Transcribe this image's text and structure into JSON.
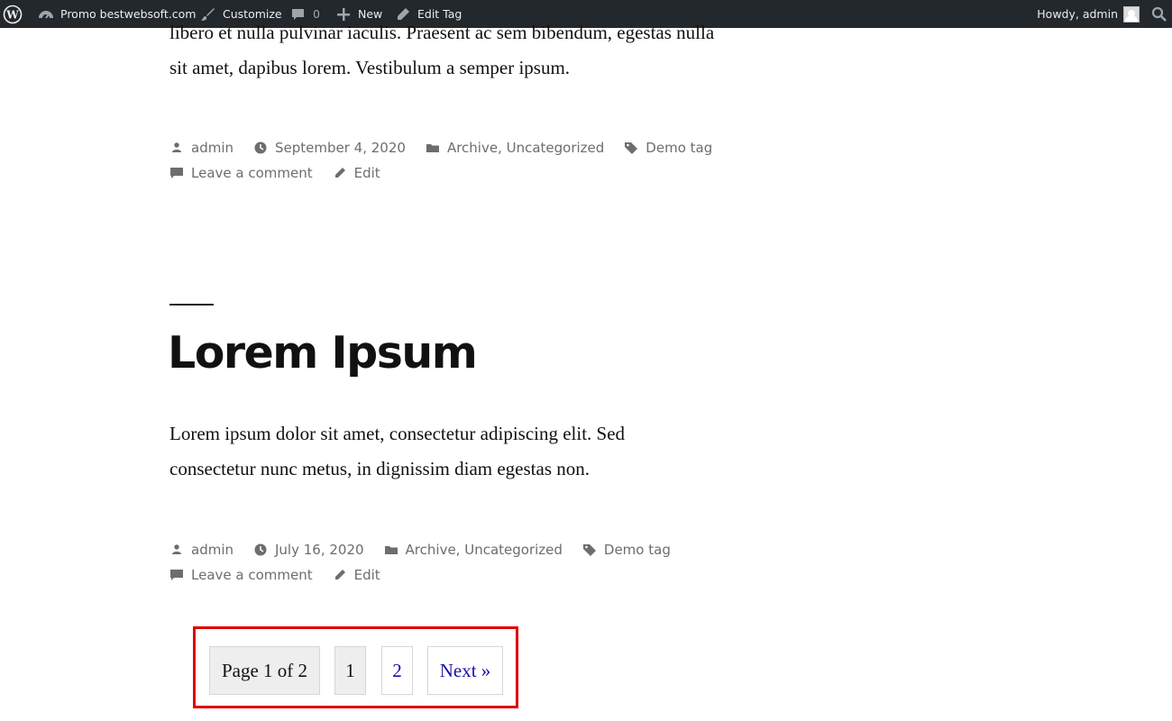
{
  "adminbar": {
    "wp_logo": "wordpress-logo-icon",
    "site_name": "Promo bestwebsoft.com",
    "customize": "Customize",
    "comments_count": "0",
    "new": "New",
    "edit_tag": "Edit Tag",
    "howdy": "Howdy, admin"
  },
  "previous_post": {
    "excerpt_line1": "libero et nulla pulvinar iaculis. Praesent ac sem bibendum, egestas nulla",
    "excerpt_line2": "sit amet, dapibus lorem. Vestibulum a semper ipsum.",
    "meta": {
      "author": "admin",
      "date": "September 4, 2020",
      "categories": "Archive, Uncategorized",
      "tags": "Demo tag",
      "comment": "Leave a comment",
      "edit": "Edit"
    }
  },
  "post": {
    "title": "Lorem Ipsum",
    "excerpt_line1": "Lorem ipsum dolor sit amet, consectetur adipiscing elit. Sed",
    "excerpt_line2": "consectetur nunc metus, in dignissim diam egestas non.",
    "meta": {
      "author": "admin",
      "date": "July 16, 2020",
      "categories": "Archive, Uncategorized",
      "tags": "Demo tag",
      "comment": "Leave a comment",
      "edit": "Edit"
    }
  },
  "pagination": {
    "info": "Page 1 of 2",
    "pages": [
      "1",
      "2"
    ],
    "current": "1",
    "next": "Next »"
  },
  "colors": {
    "adminbar_bg": "#23282d",
    "link": "#1a0dab",
    "highlight": "#e00000",
    "meta_text": "#6d6d6d"
  }
}
